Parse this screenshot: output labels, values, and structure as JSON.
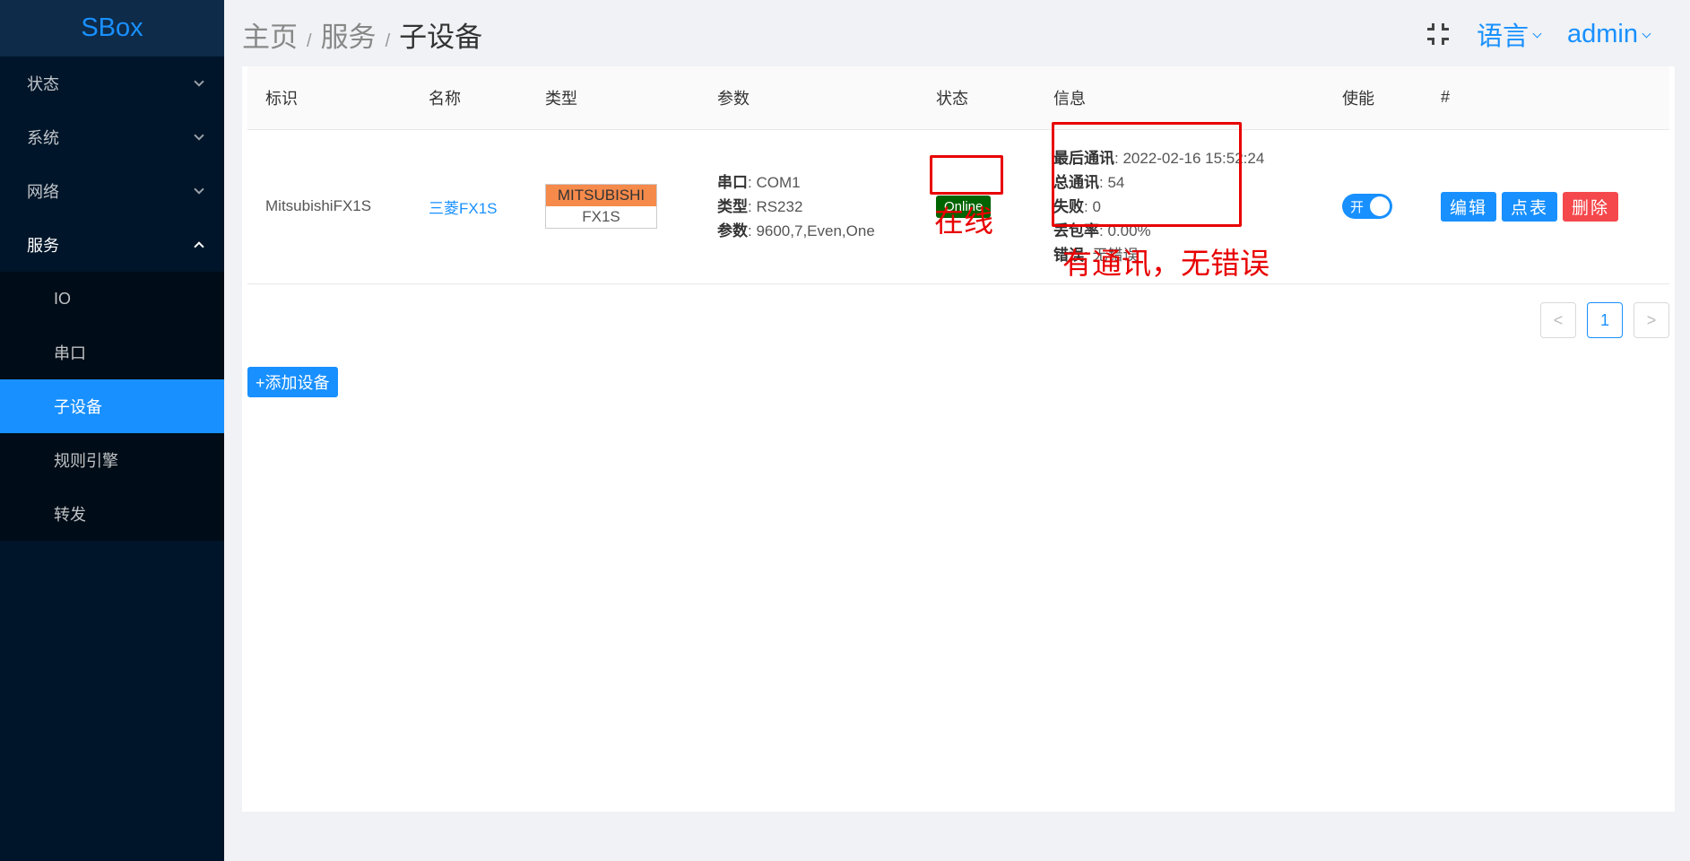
{
  "app": {
    "logo": "SBox"
  },
  "sidebar": {
    "items": [
      {
        "label": "状态",
        "chevron": "chevron-down-icon"
      },
      {
        "label": "系统",
        "chevron": "chevron-down-icon"
      },
      {
        "label": "网络",
        "chevron": "chevron-down-icon"
      },
      {
        "label": "服务",
        "chevron": "chevron-up-icon"
      }
    ],
    "subitems": [
      {
        "label": "IO"
      },
      {
        "label": "串口"
      },
      {
        "label": "子设备"
      },
      {
        "label": "规则引擎"
      },
      {
        "label": "转发"
      }
    ]
  },
  "header": {
    "breadcrumb": [
      "主页",
      "服务",
      "子设备"
    ],
    "separator": "/",
    "language_label": "语言",
    "user_label": "admin"
  },
  "table": {
    "columns": [
      "标识",
      "名称",
      "类型",
      "参数",
      "状态",
      "信息",
      "使能",
      "#"
    ],
    "rows": [
      {
        "id": "MitsubishiFX1S",
        "name": "三菱FX1S",
        "type_brand": "MITSUBISHI",
        "type_model": "FX1S",
        "params": [
          {
            "key": "串口",
            "value": ": COM1"
          },
          {
            "key": "类型",
            "value": ": RS232"
          },
          {
            "key": "参数",
            "value": ": 9600,7,Even,One"
          }
        ],
        "status": "Online",
        "info": [
          {
            "key": "最后通讯",
            "value": ": 2022-02-16 15:52:24"
          },
          {
            "key": "总通讯",
            "value": ": 54"
          },
          {
            "key": "失败",
            "value": ": 0"
          },
          {
            "key": "丢包率",
            "value": ": 0.00%"
          },
          {
            "key": "错误",
            "value": ": 无错误"
          }
        ],
        "enabled_label": "开",
        "actions": {
          "edit": "编辑",
          "points": "点表",
          "delete": "删除"
        }
      }
    ]
  },
  "annotations": {
    "status_note": "在线",
    "info_note": "有通讯，无错误"
  },
  "pagination": {
    "prev": "<",
    "current": "1",
    "next": ">"
  },
  "add_button": "+添加设备",
  "colors": {
    "accent": "#1890ff",
    "sidebar": "#001529",
    "online": "#006400",
    "annotation": "#e80000",
    "danger": "#f5484c",
    "brand": "#f58a4b"
  }
}
